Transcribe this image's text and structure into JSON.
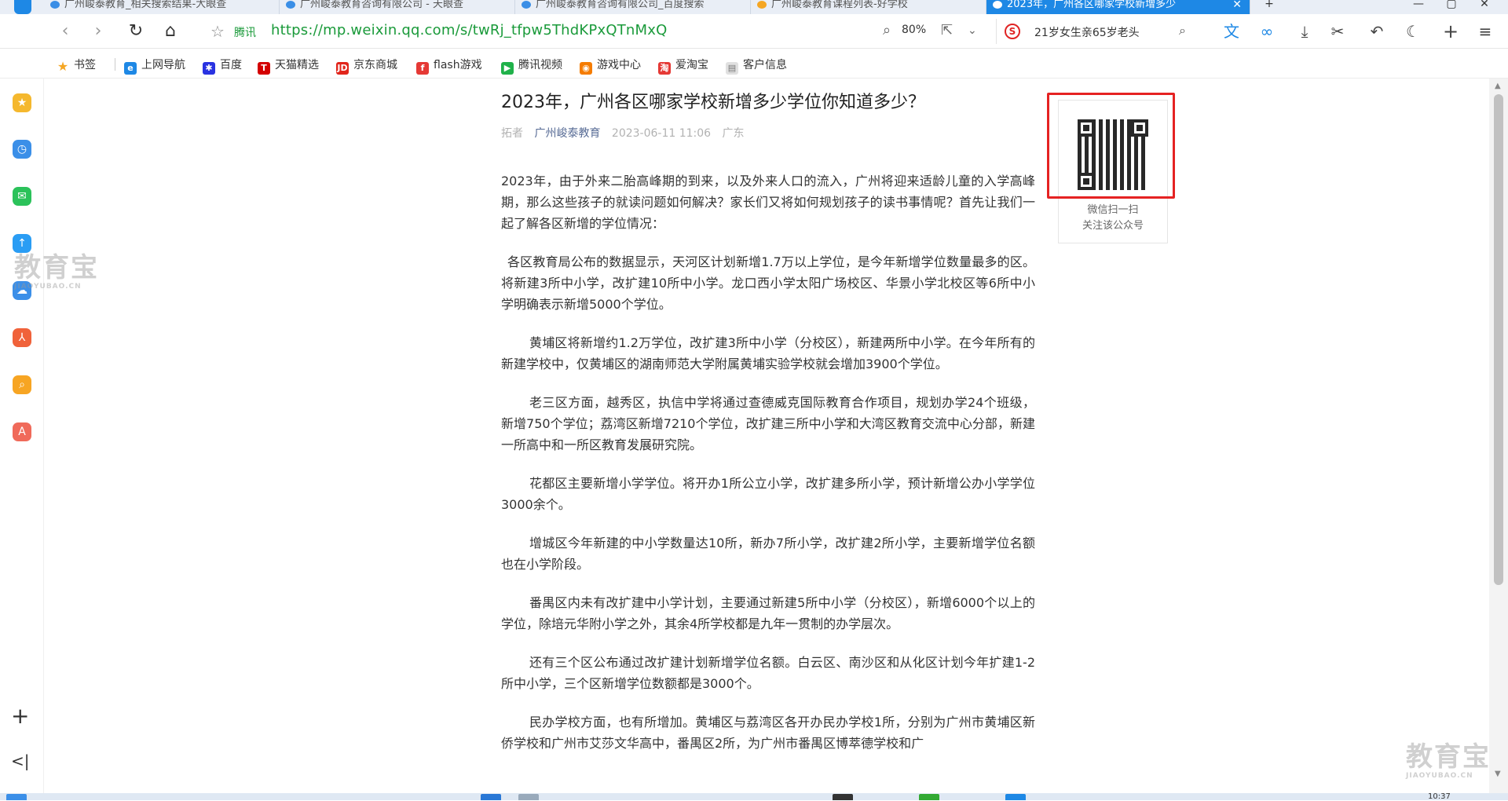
{
  "tabs": [
    {
      "label": "广州峻泰教育_相关搜索结果-大眼查"
    },
    {
      "label": "广州峻泰教育咨询有限公司 - 天眼查"
    },
    {
      "label": "广州峻泰教育咨询有限公司_百度搜索"
    },
    {
      "label": "广州峻泰教育课程列表-好学校"
    },
    {
      "label": "2023年，广州各区哪家学校新增多少"
    }
  ],
  "window": {
    "minimize": "—",
    "maximize": "▢",
    "close": "✕",
    "new_tab": "+"
  },
  "address_bar": {
    "site_label": "腾讯",
    "url": "https://mp.weixin.qq.com/s/twRj_tfpw5ThdKPxQTnMxQ",
    "zoom": "80%",
    "search_text": "21岁女生亲65岁老头"
  },
  "bookmarks": [
    {
      "label": "书签",
      "icon": "star-icon",
      "color": "#f5a623"
    },
    {
      "label": "上网导航",
      "icon": "e-icon",
      "color": "#1e88e5"
    },
    {
      "label": "百度",
      "icon": "baidu-paw-icon",
      "color": "#2932e1"
    },
    {
      "label": "天猫精选",
      "icon": "tmall-icon",
      "color": "#d40000"
    },
    {
      "label": "京东商城",
      "icon": "jd-icon",
      "color": "#e1251b"
    },
    {
      "label": "flash游戏",
      "icon": "flash-icon",
      "color": "#e53935"
    },
    {
      "label": "腾讯视频",
      "icon": "tencent-video-icon",
      "color": "#20b14a"
    },
    {
      "label": "游戏中心",
      "icon": "gamepad-icon",
      "color": "#f57c00"
    },
    {
      "label": "爱淘宝",
      "icon": "ai-taobao-icon",
      "color": "#e53935"
    },
    {
      "label": "客户信息",
      "icon": "doc-icon",
      "color": "#9e9e9e"
    }
  ],
  "watermark": {
    "big": "教育宝",
    "small": "JIAOYUBAO.CN"
  },
  "article": {
    "title": "2023年，广州各区哪家学校新增多少学位你知道多少？",
    "meta": {
      "tag": "拓者",
      "account": "广州峻泰教育",
      "time": "2023-06-11 11:06",
      "region": "广东"
    },
    "paragraphs": [
      "2023年，由于外来二胎高峰期的到来，以及外来人口的流入，广州将迎来适龄儿童的入学高峰期，那么这些孩子的就读问题如何解决？家长们又将如何规划孩子的读书事情呢？首先让我们一起了解各区新增的学位情况：",
      "各区教育局公布的数据显示，天河区计划新增1.7万以上学位，是今年新增学位数量最多的区。将新建3所中小学，改扩建10所中小学。龙口西小学太阳广场校区、华景小学北校区等6所中小学明确表示新增5000个学位。",
      "黄埔区将新增约1.2万学位，改扩建3所中小学（分校区），新建两所中小学。在今年所有的新建学校中，仅黄埔区的湖南师范大学附属黄埔实验学校就会增加3900个学位。",
      "老三区方面，越秀区，执信中学将通过查德威克国际教育合作项目，规划办学24个班级，新增750个学位；荔湾区新增7210个学位，改扩建三所中小学和大湾区教育交流中心分部，新建一所高中和一所区教育发展研究院。",
      "花都区主要新增小学学位。将开办1所公立小学，改扩建多所小学，预计新增公办小学学位3000余个。",
      "增城区今年新建的中小学数量达10所，新办7所小学，改扩建2所小学，主要新增学位名额也在小学阶段。",
      "番禺区内未有改扩建中小学计划，主要通过新建5所中小学（分校区），新增6000个以上的学位，除培元华附小学之外，其余4所学校都是九年一贯制的办学层次。",
      "还有三个区公布通过改扩建计划新增学位名额。白云区、南沙区和从化区计划今年扩建1-2所中小学，三个区新增学位数额都是3000个。",
      "民办学校方面，也有所增加。黄埔区与荔湾区各开办民办学校1所，分别为广州市黄埔区新侨学校和广州市艾莎文华高中，番禺区2所，为广州市番禺区博萃德学校和广"
    ]
  },
  "qr_panel": {
    "line1": "微信扫一扫",
    "line2": "关注该公众号"
  },
  "taskbar": {
    "clock": "10:37"
  },
  "colors": {
    "accent": "#1e88e5",
    "url_green": "#1a9a3a",
    "highlight_box": "#e52222",
    "account_link": "#576b95"
  }
}
